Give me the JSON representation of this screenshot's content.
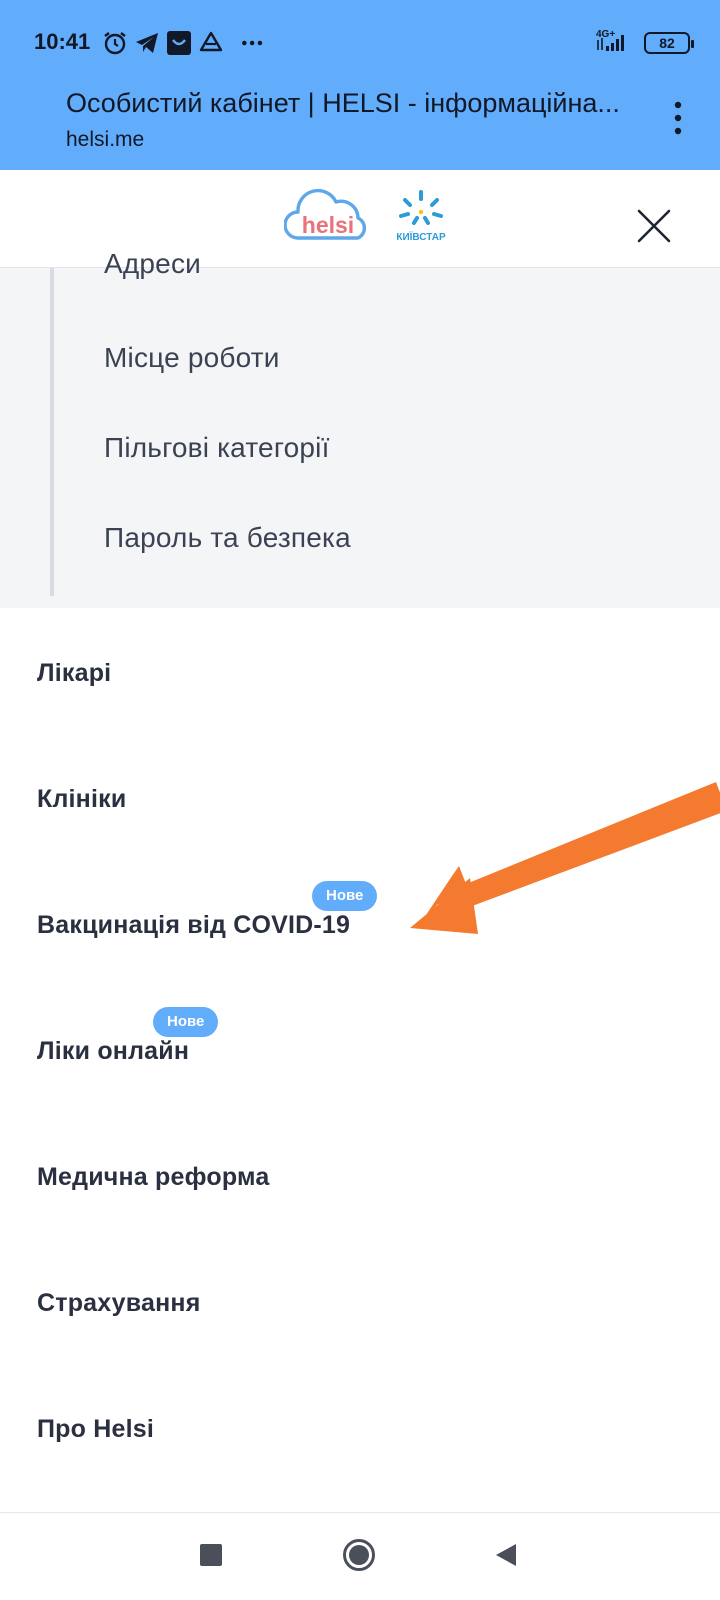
{
  "status_bar": {
    "time": "10:41",
    "network": "4G+",
    "battery": "82",
    "icons": [
      "alarm-icon",
      "telegram-icon",
      "shop-icon",
      "drive-icon",
      "more-dots-icon",
      "signal-icon",
      "battery-icon"
    ]
  },
  "browser": {
    "page_title": "Особистий кабінет | HELSI - інформаційна...",
    "url": "helsi.me"
  },
  "header": {
    "helsi_logo_text": "helsi",
    "kyivstar_logo_text": "КИЇВСТАР"
  },
  "profile_submenu": {
    "items": [
      "Адреси",
      "Місце роботи",
      "Пільгові категорії",
      "Пароль та безпека"
    ]
  },
  "main_nav": {
    "items": [
      {
        "label": "Лікарі"
      },
      {
        "label": "Клініки"
      },
      {
        "label": "Вакцинація від COVID-19",
        "badge": "Нове"
      },
      {
        "label": "Ліки онлайн",
        "badge": "Нове"
      },
      {
        "label": "Медична реформа"
      },
      {
        "label": "Страхування"
      },
      {
        "label": "Про Helsi"
      }
    ]
  },
  "colors": {
    "chrome": "#62acfc",
    "badge": "#62acfc",
    "arrow": "#f47a2f",
    "helsi_blue": "#5ea7ea",
    "helsi_red": "#e9737a",
    "kyivstar_blue": "#2c9bd6",
    "kyivstar_yellow": "#f6c417"
  }
}
